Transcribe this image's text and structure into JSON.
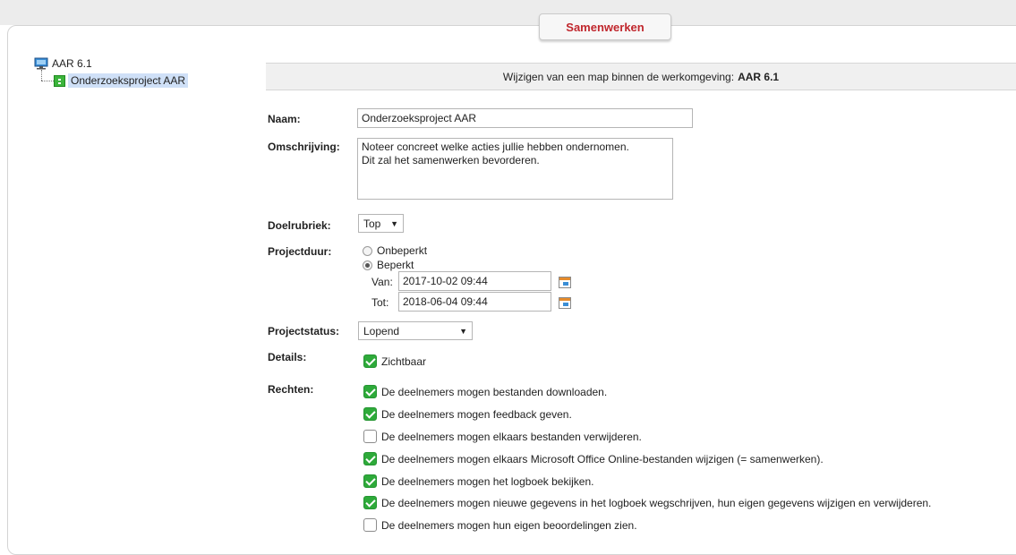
{
  "tab": {
    "label": "Samenwerken"
  },
  "tree": {
    "root": {
      "label": "AAR 6.1",
      "icon": "computer-icon"
    },
    "child": {
      "label": "Onderzoeksproject AAR",
      "icon": "project-folder-icon"
    }
  },
  "header": {
    "prefix": "Wijzigen van een map binnen de werkomgeving:",
    "workspace": "AAR 6.1"
  },
  "form": {
    "naam": {
      "label": "Naam:",
      "value": "Onderzoeksproject AAR"
    },
    "omschrijving": {
      "label": "Omschrijving:",
      "value": "Noteer concreet welke acties jullie hebben ondernomen.\nDit zal het samenwerken bevorderen."
    },
    "doelrubriek": {
      "label": "Doelrubriek:",
      "value": "Top"
    },
    "projectduur": {
      "label": "Projectduur:",
      "options": [
        {
          "label": "Onbeperkt",
          "selected": false
        },
        {
          "label": "Beperkt",
          "selected": true
        }
      ],
      "van": {
        "label": "Van:",
        "value": "2017-10-02 09:44"
      },
      "tot": {
        "label": "Tot:",
        "value": "2018-06-04 09:44"
      }
    },
    "projectstatus": {
      "label": "Projectstatus:",
      "value": "Lopend"
    },
    "details": {
      "label": "Details:",
      "items": [
        {
          "label": "Zichtbaar",
          "checked": true
        }
      ]
    },
    "rechten": {
      "label": "Rechten:",
      "items": [
        {
          "label": "De deelnemers mogen bestanden downloaden.",
          "checked": true
        },
        {
          "label": "De deelnemers mogen feedback geven.",
          "checked": true
        },
        {
          "label": "De deelnemers mogen elkaars bestanden verwijderen.",
          "checked": false
        },
        {
          "label": "De deelnemers mogen elkaars Microsoft Office Online-bestanden wijzigen (= samenwerken).",
          "checked": true
        },
        {
          "label": "De deelnemers mogen het logboek bekijken.",
          "checked": true
        },
        {
          "label": "De deelnemers mogen nieuwe gegevens in het logboek wegschrijven, hun eigen gegevens wijzigen en verwijderen.",
          "checked": true
        },
        {
          "label": "De deelnemers mogen hun eigen beoordelingen zien.",
          "checked": false
        }
      ]
    }
  },
  "colors": {
    "tab_text": "#c0272d",
    "check_green": "#2eaa3a",
    "tree_selected": "#cfe0f7"
  }
}
